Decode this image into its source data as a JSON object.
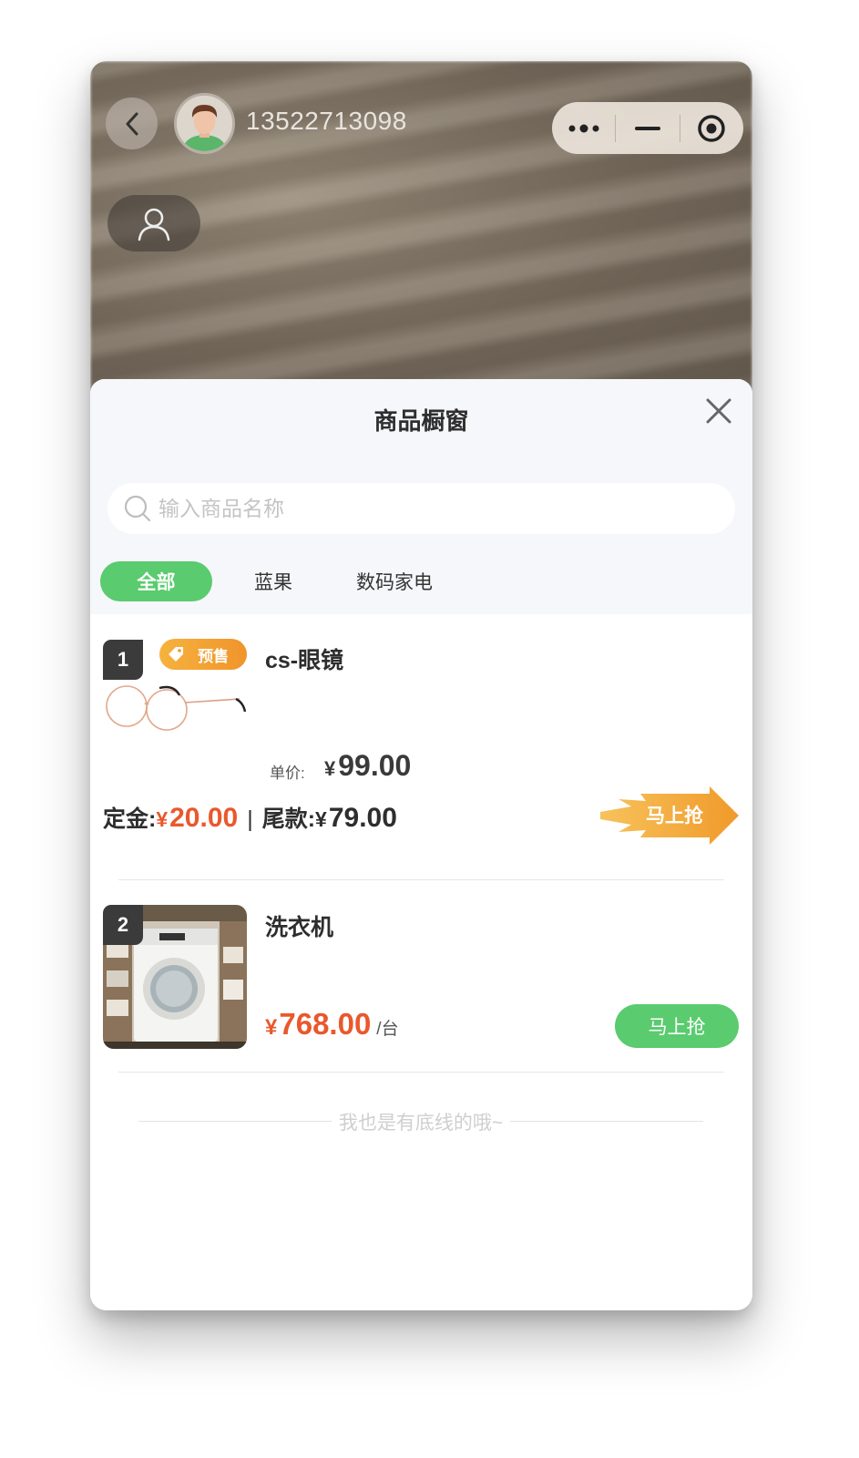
{
  "header": {
    "phone_number": "13522713098",
    "back_icon": "chevron-left-icon",
    "menu_icons": [
      "more-dots-icon",
      "minimize-icon",
      "target-icon"
    ],
    "profile_icon": "user-icon"
  },
  "sheet": {
    "title": "商品橱窗",
    "close_icon": "close-icon",
    "search": {
      "placeholder": "输入商品名称",
      "value": ""
    },
    "tabs": [
      {
        "label": "全部",
        "active": true
      },
      {
        "label": "蓝果",
        "active": false
      },
      {
        "label": "数码家电",
        "active": false
      }
    ],
    "accent_color": "#5acb6e",
    "price_color": "#e9582d"
  },
  "products": [
    {
      "rank": "1",
      "badge": "预售",
      "title": "cs-眼镜",
      "unit_label": "单价:",
      "unit_currency": "¥",
      "unit_price": "99.00",
      "deposit_label": "定金:",
      "deposit_currency": "¥",
      "deposit_price": "20.00",
      "separator": "|",
      "balance_label": "尾款:",
      "balance_currency": "¥",
      "balance_price": "79.00",
      "button_label": "马上抢"
    },
    {
      "rank": "2",
      "title": "洗衣机",
      "currency": "¥",
      "price": "768.00",
      "per_unit": "/台",
      "button_label": "马上抢"
    }
  ],
  "footer_note": "我也是有底线的哦~"
}
